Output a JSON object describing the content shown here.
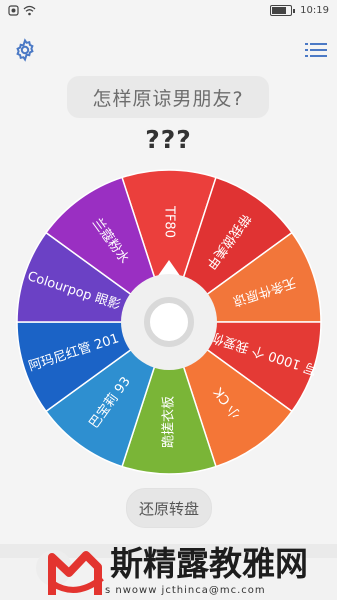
{
  "status": {
    "time": "10:19"
  },
  "question": "怎样原谅男朋友?",
  "result": "???",
  "wheel": {
    "segments": [
      {
        "label": "TF80",
        "color": "#eb3f3c"
      },
      {
        "label": "带我做美甲",
        "color": "#e03333"
      },
      {
        "label": "无条件原谅",
        "color": "#f2763a"
      },
      {
        "label": "写 1000 个 我爱你",
        "color": "#e43a35"
      },
      {
        "label": "小 CK",
        "color": "#f47637"
      },
      {
        "label": "跪搓衣板",
        "color": "#7ab537"
      },
      {
        "label": "巴宝莉 93",
        "color": "#2e8fd0"
      },
      {
        "label": "阿玛尼红管 201",
        "color": "#1b63c6"
      },
      {
        "label": "Colourpop 眼影",
        "color": "#6b41c5"
      },
      {
        "label": "兰蔻粉水",
        "color": "#9a2fc2"
      }
    ]
  },
  "reset_label": "还原转盘",
  "watermark": {
    "text": "斯精露教雅网",
    "url": "s   nwoww jcthinca@mc.com"
  }
}
